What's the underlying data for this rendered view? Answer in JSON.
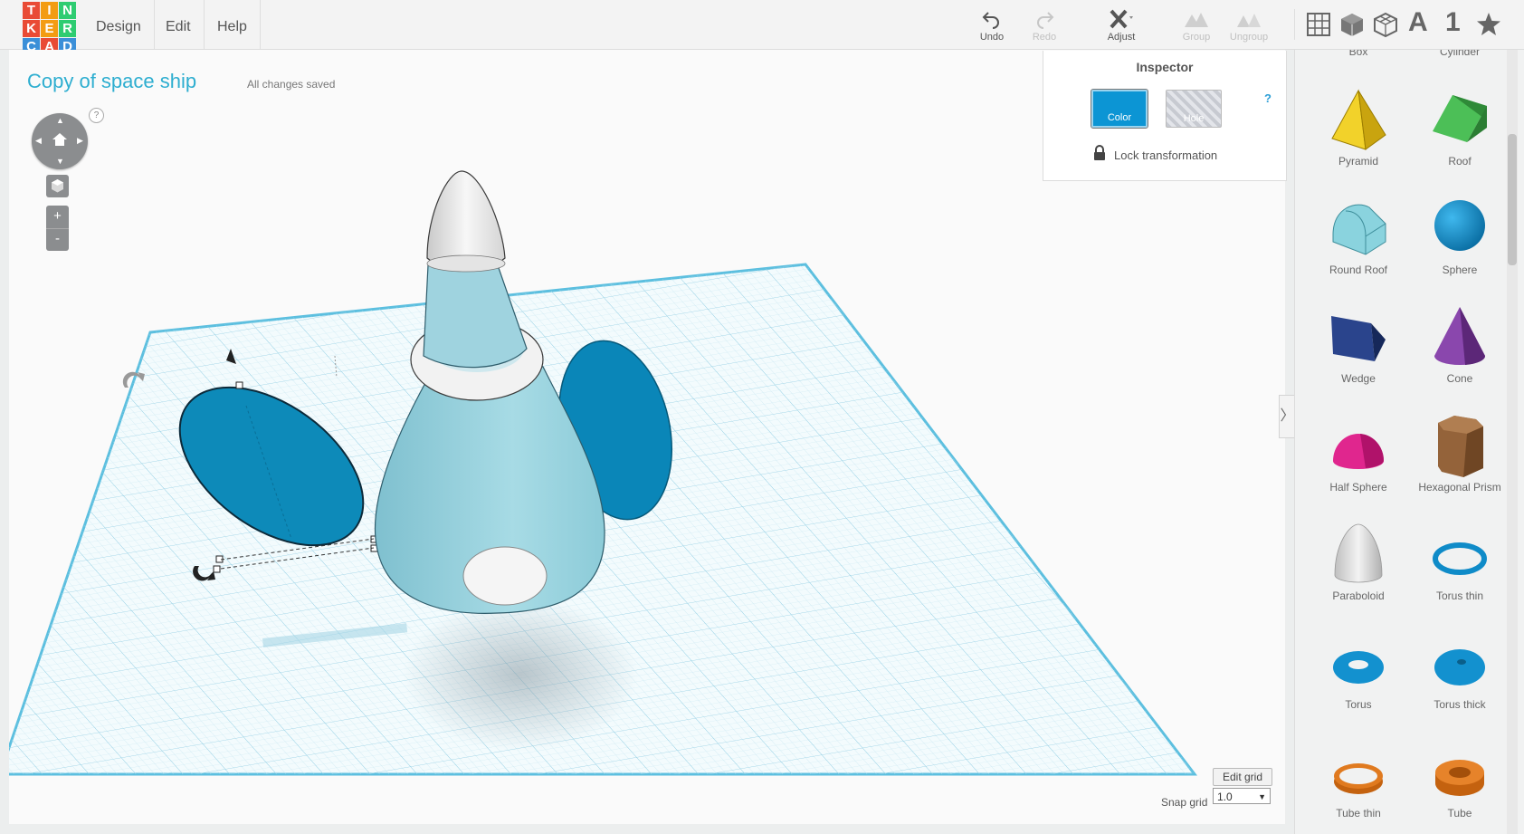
{
  "app": {
    "logo_letters": [
      "T",
      "I",
      "N",
      "K",
      "E",
      "R",
      "C",
      "A",
      "D"
    ],
    "logo_colors": [
      "#e94b35",
      "#f39c12",
      "#2ecc71",
      "#e94b35",
      "#f39c12",
      "#2ecc71",
      "#3b8fd8",
      "#e94b35",
      "#3b8fd8"
    ]
  },
  "menu": [
    "Design",
    "Edit",
    "Help"
  ],
  "toolbar": {
    "undo": "Undo",
    "redo": "Redo",
    "adjust": "Adjust",
    "group": "Group",
    "ungroup": "Ungroup",
    "text_tool": "A",
    "number_tool": "1"
  },
  "design": {
    "title": "Copy of space ship",
    "save_status": "All changes saved"
  },
  "view": {
    "help": "?",
    "zoom_in": "+",
    "zoom_out": "-"
  },
  "inspector": {
    "title": "Inspector",
    "help": "?",
    "color_label": "Color",
    "hole_label": "Hole",
    "lock_label": "Lock transformation",
    "selected_color": "#0c95d4"
  },
  "grid": {
    "edit_label": "Edit grid",
    "snap_label": "Snap grid",
    "snap_value": "1.0"
  },
  "shapes_partial": [
    "Box",
    "Cylinder"
  ],
  "shapes": [
    {
      "name": "Pyramid",
      "color": "#e8c21a"
    },
    {
      "name": "Roof",
      "color": "#3aa845"
    },
    {
      "name": "Round Roof",
      "color": "#7fcbd8"
    },
    {
      "name": "Sphere",
      "color": "#1391cf"
    },
    {
      "name": "Wedge",
      "color": "#22397a"
    },
    {
      "name": "Cone",
      "color": "#7a3c9c"
    },
    {
      "name": "Half Sphere",
      "color": "#de1f8a"
    },
    {
      "name": "Hexagonal Prism",
      "color": "#8a5a32"
    },
    {
      "name": "Paraboloid",
      "color": "#dcdcdc"
    },
    {
      "name": "Torus thin",
      "color": "#1391cf"
    },
    {
      "name": "Torus",
      "color": "#1391cf"
    },
    {
      "name": "Torus thick",
      "color": "#1391cf"
    },
    {
      "name": "Tube thin",
      "color": "#e07a1f"
    },
    {
      "name": "Tube",
      "color": "#e07a1f"
    }
  ]
}
